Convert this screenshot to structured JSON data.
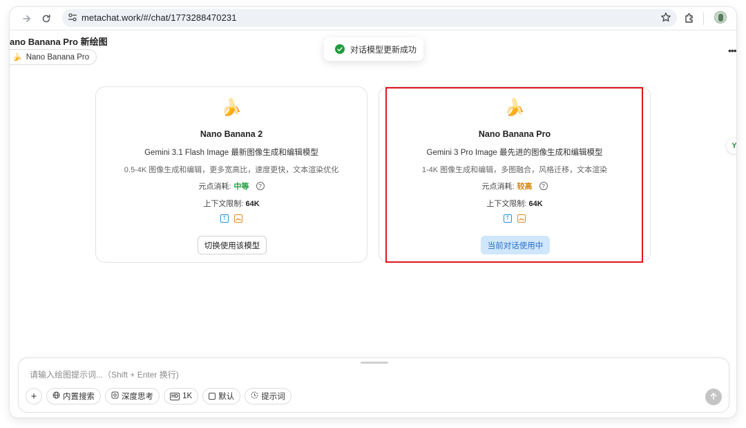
{
  "browser": {
    "url": "metachat.work/#/chat/1773288470231"
  },
  "page": {
    "title": "ano Banana Pro 新绘图",
    "chip_label": "Nano Banana Pro"
  },
  "toast": {
    "message": "对话模型更新成功"
  },
  "side_float": {
    "label": "Y"
  },
  "cards": [
    {
      "icon": "🍌",
      "name": "Nano Banana 2",
      "description": "Gemini 3.1 Flash Image 最新图像生成和编辑模型",
      "features": "0.5-4K 图像生成和编辑，更多宽高比，速度更快，文本渲染优化",
      "cost_label": "元点消耗:",
      "cost_value": "中等",
      "context_label": "上下文限制:",
      "context_value": "64K",
      "button_label": "切换使用该模型"
    },
    {
      "icon": "🍌",
      "name": "Nano Banana Pro",
      "description": "Gemini 3 Pro Image 最先进的图像生成和编辑模型",
      "features": "1-4K 图像生成和编辑，多图融合，风格迁移，文本渲染",
      "cost_label": "元点消耗:",
      "cost_value": "较高",
      "context_label": "上下文限制:",
      "context_value": "64K",
      "button_label": "当前对话使用中"
    }
  ],
  "composer": {
    "placeholder": "请输入绘图提示词...（Shift + Enter 换行)",
    "tools": {
      "search": "内置搜索",
      "think": "深度思考",
      "resolution": "1K",
      "ratio": "默认",
      "prompt": "提示词"
    }
  },
  "colors": {
    "cost_medium": "#1f9d3c",
    "cost_high": "#d6860a",
    "highlight": "#e0131d",
    "active_button_bg": "#cfe6fb"
  }
}
